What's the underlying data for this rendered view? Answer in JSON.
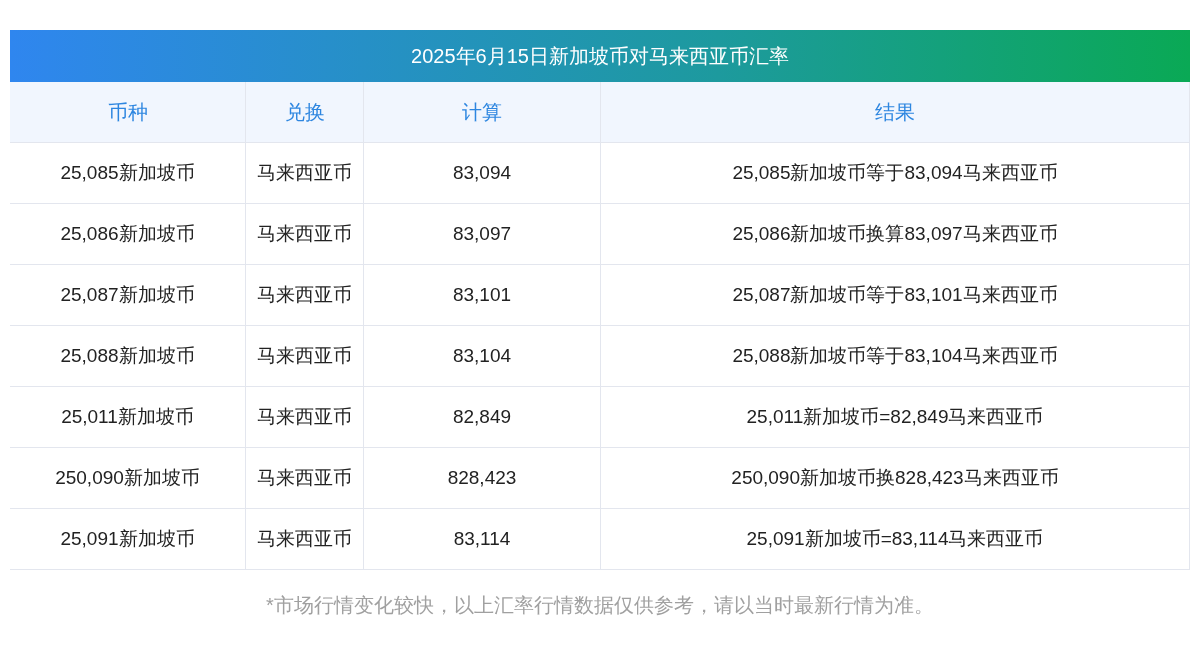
{
  "title": "2025年6月15日新加坡币对马来西亚币汇率",
  "columns": [
    "币种",
    "兑换",
    "计算",
    "结果"
  ],
  "rows": [
    [
      "25,085新加坡币",
      "马来西亚币",
      "83,094",
      "25,085新加坡币等于83,094马来西亚币"
    ],
    [
      "25,086新加坡币",
      "马来西亚币",
      "83,097",
      "25,086新加坡币换算83,097马来西亚币"
    ],
    [
      "25,087新加坡币",
      "马来西亚币",
      "83,101",
      "25,087新加坡币等于83,101马来西亚币"
    ],
    [
      "25,088新加坡币",
      "马来西亚币",
      "83,104",
      "25,088新加坡币等于83,104马来西亚币"
    ],
    [
      "25,011新加坡币",
      "马来西亚币",
      "82,849",
      "25,011新加坡币=82,849马来西亚币"
    ],
    [
      "250,090新加坡币",
      "马来西亚币",
      "828,423",
      "250,090新加坡币换828,423马来西亚币"
    ],
    [
      "25,091新加坡币",
      "马来西亚币",
      "83,114",
      "25,091新加坡币=83,114马来西亚币"
    ]
  ],
  "footnote": "*市场行情变化较快，以上汇率行情数据仅供参考，请以当时最新行情为准。"
}
